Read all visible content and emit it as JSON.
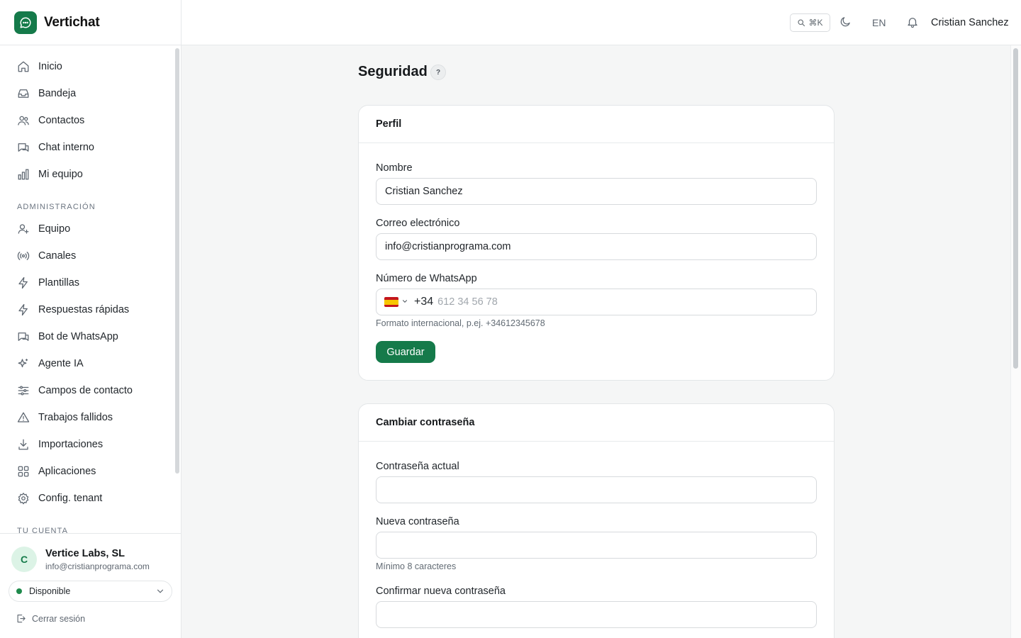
{
  "app": {
    "name": "Vertichat"
  },
  "topbar": {
    "search_shortcut": "⌘K",
    "language": "EN",
    "user_name": "Cristian Sanchez"
  },
  "sidebar": {
    "items": [
      {
        "label": "Inicio",
        "icon": "home-icon"
      },
      {
        "label": "Bandeja",
        "icon": "inbox-icon"
      },
      {
        "label": "Contactos",
        "icon": "users-icon"
      },
      {
        "label": "Chat interno",
        "icon": "chat-icon"
      },
      {
        "label": "Mi equipo",
        "icon": "bar-chart-icon"
      }
    ],
    "admin_section": "ADMINISTRACIÓN",
    "admin_items": [
      {
        "label": "Equipo",
        "icon": "user-plus-icon"
      },
      {
        "label": "Canales",
        "icon": "broadcast-icon"
      },
      {
        "label": "Plantillas",
        "icon": "bolt-icon"
      },
      {
        "label": "Respuestas rápidas",
        "icon": "bolt-icon"
      },
      {
        "label": "Bot de WhatsApp",
        "icon": "chat-icon"
      },
      {
        "label": "Agente IA",
        "icon": "sparkles-icon"
      },
      {
        "label": "Campos de contacto",
        "icon": "sliders-icon"
      },
      {
        "label": "Trabajos fallidos",
        "icon": "warning-icon"
      },
      {
        "label": "Importaciones",
        "icon": "download-icon"
      },
      {
        "label": "Aplicaciones",
        "icon": "grid-icon"
      },
      {
        "label": "Config. tenant",
        "icon": "gear-icon"
      }
    ],
    "account_section": "TU CUENTA"
  },
  "account": {
    "initial": "C",
    "org_name": "Vertice Labs, SL",
    "email": "info@cristianprograma.com",
    "status": "Disponible",
    "status_color": "#1f8a4c",
    "logout": "Cerrar sesión"
  },
  "page": {
    "title": "Seguridad",
    "help": "?"
  },
  "profile": {
    "title": "Perfil",
    "name_label": "Nombre",
    "name_value": "Cristian Sanchez",
    "email_label": "Correo electrónico",
    "email_value": "info@cristianprograma.com",
    "whatsapp_label": "Número de WhatsApp",
    "dial_code": "+34",
    "whatsapp_placeholder": "612 34 56 78",
    "whatsapp_hint": "Formato internacional, p.ej. +34612345678",
    "save": "Guardar"
  },
  "password": {
    "title": "Cambiar contraseña",
    "current_label": "Contraseña actual",
    "new_label": "Nueva contraseña",
    "new_hint": "Mínimo 8 caracteres",
    "confirm_label": "Confirmar nueva contraseña"
  },
  "colors": {
    "accent": "#157a4a"
  }
}
